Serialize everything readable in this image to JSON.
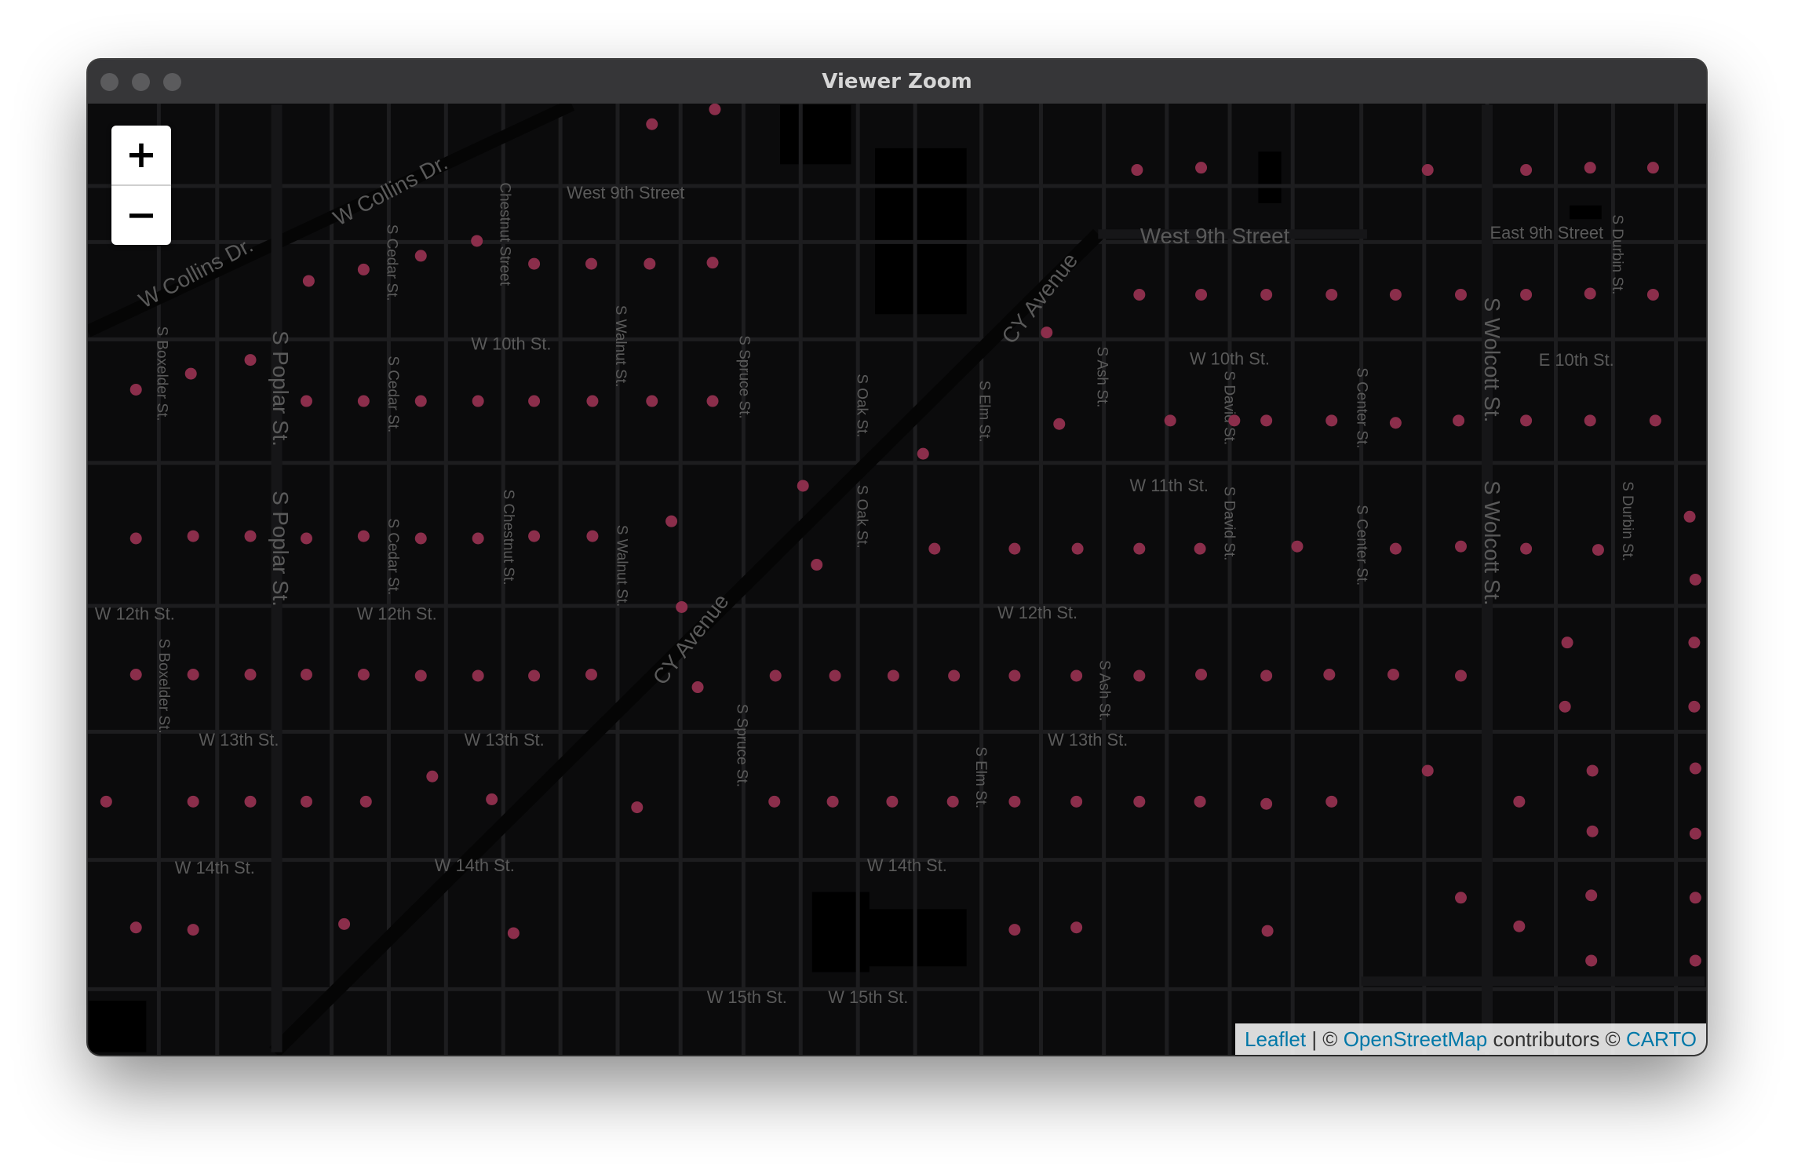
{
  "window": {
    "title": "Viewer Zoom"
  },
  "zoom_control": {
    "zoom_in_label": "+",
    "zoom_out_label": "−"
  },
  "attribution": {
    "leaflet_link": "Leaflet",
    "separator": " | © ",
    "osm_link": "OpenStreetMap",
    "contributors_text": " contributors © ",
    "carto_link": "CARTO"
  },
  "map": {
    "basemap": "dark",
    "marker_color": "#8b2e4b",
    "street_labels": [
      "West 9th Street",
      "West 9th Street",
      "East 9th Street",
      "W 10th St.",
      "W 10th St.",
      "E 10th St.",
      "W 11th St.",
      "W 12th St.",
      "W 12th St.",
      "W 12th St.",
      "W 13th St.",
      "W 13th St.",
      "W 13th St.",
      "W 14th St.",
      "W 14th St.",
      "W 14th St.",
      "W 15th St.",
      "W 15th St.",
      "W Collins Dr.",
      "W Collins Dr.",
      "CY Avenue",
      "CY Avenue",
      "S Poplar St.",
      "S Poplar St.",
      "S Wolcott St.",
      "S Wolcott St.",
      "S Boxelder St.",
      "S Boxelder St.",
      "S Cedar St.",
      "S Cedar St.",
      "S Cedar St.",
      "Chestnut Street",
      "S Chestnut St.",
      "S Walnut St.",
      "S Walnut St.",
      "S Spruce St.",
      "S Spruce St.",
      "S Oak St.",
      "S Oak St.",
      "S Elm St.",
      "S Elm St.",
      "S Ash St.",
      "S Ash St.",
      "S David St.",
      "S David St.",
      "S Center St.",
      "S Center St.",
      "S Durbin St.",
      "S Durbin St."
    ]
  }
}
